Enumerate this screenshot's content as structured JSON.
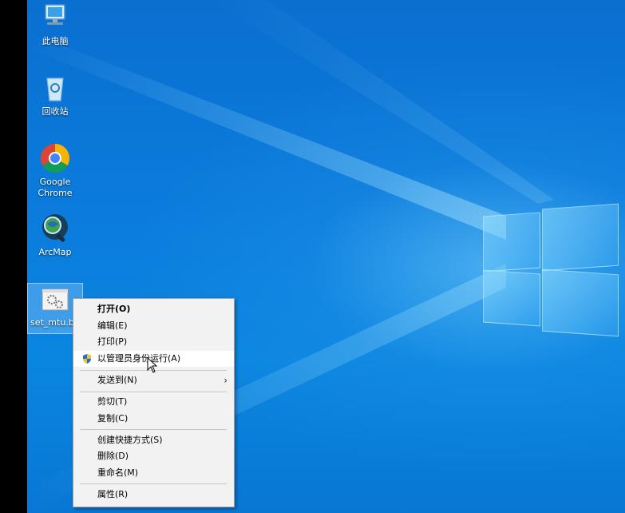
{
  "desktop_icons": [
    {
      "label": "此电脑"
    },
    {
      "label": "回收站"
    },
    {
      "label": "Google Chrome",
      "line1": "Google",
      "line2": "Chrome"
    },
    {
      "label": "ArcMap"
    },
    {
      "label": "set_mtu.ba"
    }
  ],
  "context_menu": {
    "items": [
      {
        "label": "打开(O)",
        "bold": true
      },
      {
        "label": "编辑(E)"
      },
      {
        "label": "打印(P)"
      },
      {
        "label": "以管理员身份运行(A)",
        "icon": "shield-icon",
        "hovered": true
      },
      {
        "label": "发送到(N)",
        "submenu": true
      },
      {
        "label": "剪切(T)"
      },
      {
        "label": "复制(C)"
      },
      {
        "label": "创建快捷方式(S)"
      },
      {
        "label": "删除(D)"
      },
      {
        "label": "重命名(M)"
      },
      {
        "label": "属性(R)"
      }
    ]
  },
  "colors": {
    "accent": "#0b7ddd",
    "menu_bg": "#f2f2f2"
  }
}
